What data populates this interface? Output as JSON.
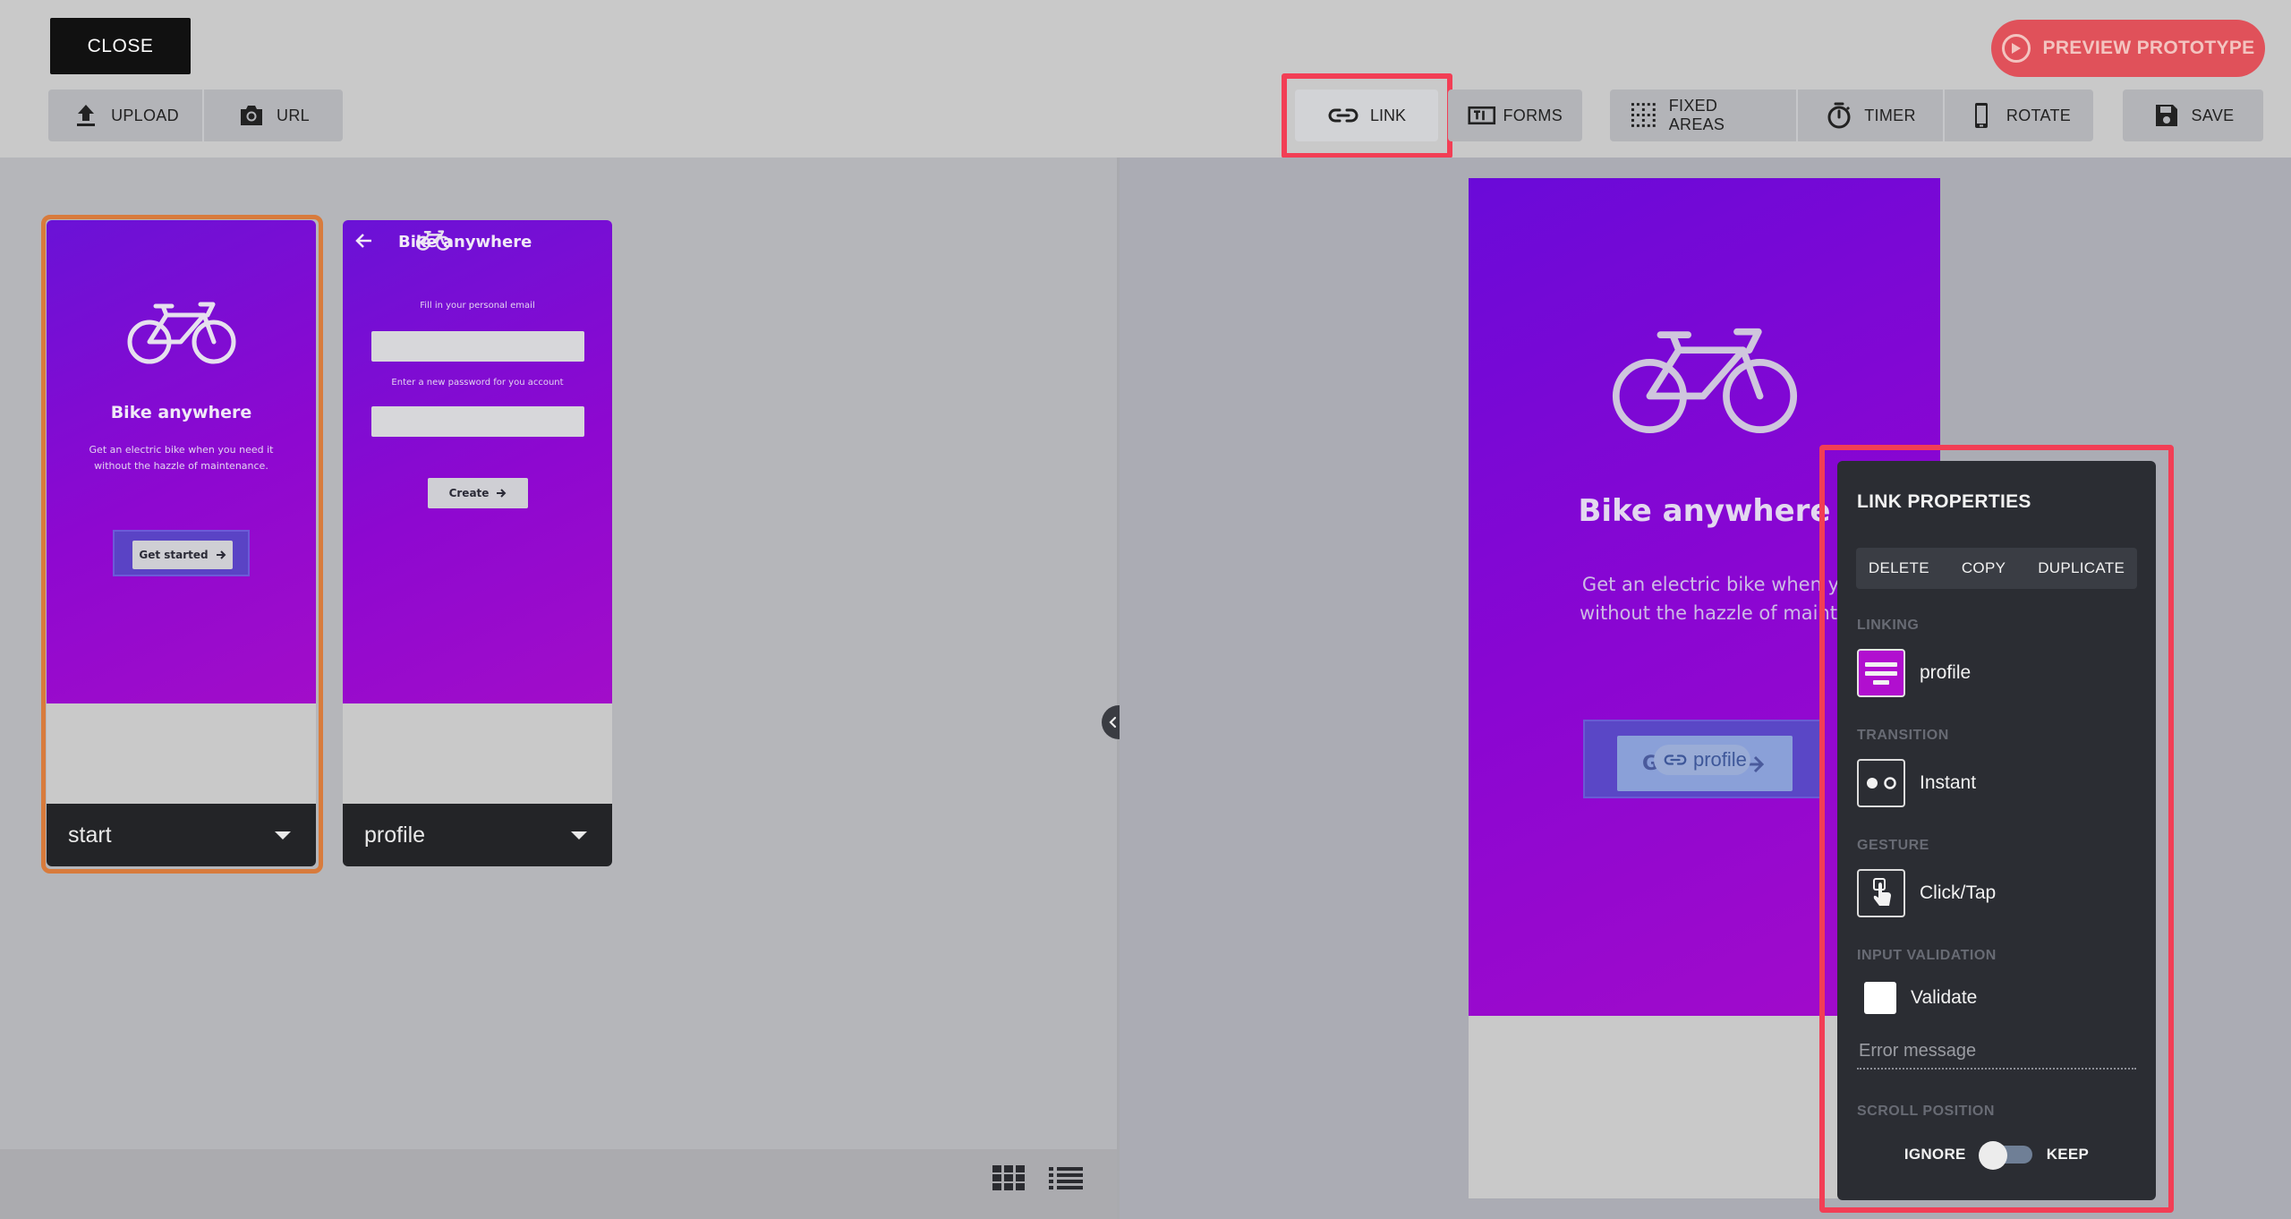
{
  "toolbar": {
    "close_label": "CLOSE",
    "preview_label": "PREVIEW PROTOTYPE",
    "upload_label": "UPLOAD",
    "url_label": "URL",
    "link_label": "LINK",
    "forms_label": "FORMS",
    "fixed_areas_label": "FIXED AREAS",
    "timer_label": "TIMER",
    "rotate_label": "ROTATE",
    "save_label": "SAVE"
  },
  "screens": [
    {
      "name": "start",
      "title": "Bike anywhere",
      "text_line1": "Get an electric bike when you need it",
      "text_line2": "without the hazzle of maintenance.",
      "button": "Get started"
    },
    {
      "name": "profile",
      "title": "Bike anywhere",
      "email_label": "Fill in your personal email",
      "password_label": "Enter a new password for you account",
      "button": "Create"
    }
  ],
  "preview": {
    "title": "Bike anywhere",
    "text_line1": "Get an electric bike when you ne",
    "text_line2": "without the hazzle of maintenanc",
    "button_fragment": "G",
    "link_target": "profile"
  },
  "link_panel": {
    "title": "LINK PROPERTIES",
    "delete_label": "DELETE",
    "copy_label": "COPY",
    "duplicate_label": "DUPLICATE",
    "linking_label": "LINKING",
    "linking_value": "profile",
    "transition_label": "TRANSITION",
    "transition_value": "Instant",
    "gesture_label": "GESTURE",
    "gesture_value": "Click/Tap",
    "validation_label": "INPUT VALIDATION",
    "validate_label": "Validate",
    "validate_checked": false,
    "error_placeholder": "Error message",
    "scroll_label": "SCROLL POSITION",
    "scroll_ignore": "IGNORE",
    "scroll_keep": "KEEP"
  },
  "colors": {
    "accent_red": "#f23e55",
    "preview_button": "#e0515a",
    "selected_frame": "#d87b3c",
    "panel_bg": "#2b2d33",
    "screen_gradient_start": "#6a12d6",
    "screen_gradient_end": "#a20dc9"
  }
}
